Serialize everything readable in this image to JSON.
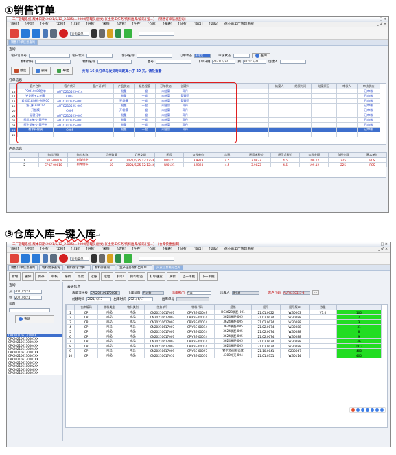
{
  "doc": {
    "heading1": "①销售订单",
    "heading2": "③仓库入库",
    "heading2_emph": "一键入库",
    "return_mark": "↵"
  },
  "shot1": {
    "title": "工厂管理系统(版本日期:2021/5/12_2.105)...2000[管理员(创始)]{主要工作务/统料出库/编码{强...} - [销售订单信息查询]",
    "window_controls": "_ □ ×",
    "menu": [
      "[系统]",
      "[经理]",
      "[业务]",
      "[工程]",
      "[计划]",
      "[供管]",
      "[采购]",
      "[品管]",
      "[生产]",
      "[仓库]",
      "[报表]",
      "[财务]",
      "[窗口]",
      "[帮助]",
      "佰小凿工厂管理系统"
    ],
    "menu_right": "_ ♂ ×",
    "search_placeholder": "查询菜单",
    "tab": "销售订单信息查询",
    "query_label": "查询",
    "form": {
      "order_no": "客户订单号",
      "customer_code": "客户代码",
      "customer_name": "客户名称",
      "order_status": "订单状态",
      "order_status_val": "未结案",
      "review_status": "审核状态",
      "query_btn": "查询",
      "material_code": "物料代码",
      "material_name": "物料名称",
      "drawing": "图号",
      "order_date": "下单日期",
      "date_from": "2021/ 5/22",
      "to": "到",
      "date_to": "2021/ 6/21",
      "creator": "创建人"
    },
    "actions": {
      "lock": "锁定",
      "delete": "删除",
      "export": "导出",
      "notice": "共有 16 条订单与发货时间距离小于 20 天，请及查看"
    },
    "orders_label": "订单信息",
    "orders_headers": [
      "",
      "客户名称",
      "客户代码",
      "客户订单号",
      "产品状态",
      "紧急程度",
      "订单状态",
      "创建人",
      "",
      "结案人",
      "结案时间",
      "结案原因",
      "审核人",
      "审核状态"
    ],
    "orders_rows": [
      [
        "16",
        "POO10486急单",
        "AUTO210525-014",
        "",
        "批量",
        "一般",
        "未结案",
        "郭丹",
        "",
        "",
        "",
        "",
        "",
        "已审核"
      ],
      [
        "17",
        "逆划图+定制窗",
        "C002",
        "",
        "批量",
        "一般",
        "未结案",
        "管理员",
        "",
        "",
        "",
        "",
        "",
        "已审核"
      ],
      [
        "18",
        "紧锁用其制作-创改00",
        "AUTO210525-001",
        "",
        "开袋模",
        "一般",
        "未结案",
        "管理员",
        "",
        "",
        "",
        "",
        "",
        "已审核"
      ],
      [
        "19",
        "急订料ADC12",
        "AUTO210525-001",
        "",
        "批量",
        "一般",
        "未结案",
        "郭丹",
        "",
        "",
        "",
        "",
        "",
        "已审核"
      ],
      [
        "20",
        "开锁模",
        "C009",
        "",
        "开袋模",
        "一般",
        "未结案",
        "郭丹",
        "",
        "",
        "",
        "",
        "",
        "已审核"
      ],
      [
        "21",
        "延验订单",
        "AUTO210525-001",
        "",
        "批量",
        "一般",
        "未结案",
        "郭丹",
        "",
        "",
        "",
        "",
        "",
        "已审核"
      ],
      [
        "22",
        "打机加单交-周子出",
        "AUTO210525-001",
        "",
        "批量",
        "一般",
        "未结案",
        "郭丹",
        "",
        "",
        "",
        "",
        "",
        "已审核"
      ],
      [
        "23",
        "打注塑单交-周子出",
        "AUTO210525-001",
        "",
        "批量",
        "一般",
        "未结案",
        "郭丹",
        "",
        "",
        "",
        "",
        "",
        "已审核"
      ],
      [
        "24",
        "刹车补偿模",
        "C005",
        "",
        "批量",
        "一般",
        "未结案",
        "郭丹",
        "",
        "",
        "",
        "",
        "",
        "已审核"
      ],
      [
        "25",
        "",
        "",
        "",
        "",
        "",
        "",
        "",
        "",
        "",
        "",
        "",
        "",
        ""
      ]
    ],
    "products_label": "产品信息",
    "products_headers": [
      "",
      "物料代码",
      "物料名称",
      "订单数量",
      "订单交期",
      "图号",
      "含税单价",
      "含税",
      "原币未税价",
      "原币含税价",
      "未税金额",
      "含税金额",
      "基本单位"
    ],
    "products_rows": [
      [
        "1",
        "CP-LT-00009",
        "刹车钳补",
        "50",
        "2021/6/25 12:12:46",
        "W.0121",
        "3.9823",
        "4.5",
        "3.9823",
        "4.5",
        "199.12",
        "225",
        "PCS"
      ],
      [
        "2",
        "CP-LT-00010",
        "刹车钳补",
        "50",
        "2021/6/25 12:12:46",
        "W.0121",
        "3.9823",
        "4.5",
        "3.9823",
        "4.5",
        "199.12",
        "225",
        "PCS"
      ]
    ]
  },
  "shot2": {
    "title": "工厂管理系统(版本日期:2021/5/12_2.105)...2000[管理员(创始)]{主要工作务/统料出库/编码{强...} - [仓库快捷出库]",
    "window_controls": "_ □ ×",
    "menu": [
      "[系统]",
      "[经理]",
      "[业务]",
      "[工程]",
      "[计划]",
      "[供管]",
      "[采购]",
      "[品管]",
      "[生产]",
      "[仓库]",
      "[报表]",
      "[财务]",
      "[窗口]",
      "[帮助]",
      "佰小凿工厂管理系统"
    ],
    "menu_right": "_ ♂ ×",
    "search_placeholder": "查询菜单",
    "tabs": [
      "销售订单信息查询",
      "物料需求查询",
      "物料需求计算...",
      "物料库查询...",
      "生产任务物料出库单...",
      "交货信息概览出库"
    ],
    "actions": [
      "新增",
      "删除",
      "保存",
      "审核",
      "编辑",
      "作废",
      "过账",
      "定位",
      "打印",
      "打印标签",
      "打印送货",
      "刷新",
      "上一单据",
      "下一单据"
    ],
    "query_label": "查询",
    "from_label": "从",
    "from_date": "2021/ 5/22",
    "to_label": "到",
    "to_date": "2021/ 6/21",
    "status_label": "状态",
    "query_btn": "查询",
    "doc_list": [
      "CPK202106170000X",
      "CPK202106170007XX",
      "CPK202106170004XX",
      "CPK202106170004XX",
      "CPK202106170004XX",
      "CPK202106170001XX",
      "CPK202106170001XX",
      "CPK202106170001XX",
      "CPK202106170001XX",
      "CPK202106110002XX",
      "CPK202106100000XX",
      "CPK202106180001XX"
    ],
    "header_label": "表头信息",
    "header": {
      "out_no_label": "表单流水号",
      "out_no": "CPK202106170006",
      "out_status_label": "出库状态",
      "out_status": "已过账",
      "dept_label": "出库部门",
      "dept": "仓库",
      "person_label": "出库人",
      "person": "郭小凿",
      "customer_label": "客户代码",
      "customer": "AUTO210525-8",
      "date_label": "创建时间",
      "date": "2021/ 6/17",
      "out_date_label": "出库时间",
      "out_date": "2021/ 6/17",
      "out_ref_label": "出库单号"
    },
    "items_headers": [
      "",
      "仓库编码",
      "物料类型",
      "物料类别",
      "任务单号",
      "物料代码",
      "规格",
      "图号",
      "图号版本",
      "数量"
    ],
    "items_rows": [
      [
        "1",
        "CP",
        "成品",
        "成品",
        "CN20210617007",
        "CP-YBE-00049",
        "HC3628装配-001",
        "21.01.0022",
        "W.30003",
        "V1.0",
        "100"
      ],
      [
        "2",
        "CP",
        "成品",
        "成品",
        "CN20210617007",
        "CP-YBE-00014",
        "3624装配-005",
        "21.02.0074",
        "W.30088",
        "",
        "7"
      ],
      [
        "3",
        "CP",
        "成品",
        "成品",
        "CN20210617007",
        "CP-YBE-00014",
        "3624装配-005",
        "21.02.0074",
        "W.30088",
        "",
        "3"
      ],
      [
        "4",
        "CP",
        "成品",
        "成品",
        "CN20210617007",
        "CP-YBE-00014",
        "3624装配-005",
        "21.02.0074",
        "W.30088",
        "",
        "31"
      ],
      [
        "5",
        "CP",
        "成品",
        "成品",
        "CN20210617007",
        "CP-YBE-00014",
        "3624装配-005",
        "21.02.0074",
        "W.30088",
        "",
        "8"
      ],
      [
        "6",
        "CP",
        "成品",
        "成品",
        "CN20210617007",
        "CP-YBE-00014",
        "3624装配-005",
        "21.02.0074",
        "W.30088",
        "",
        "9"
      ],
      [
        "7",
        "CP",
        "成品",
        "成品",
        "CN20210617007",
        "CP-YBE-00014",
        "3624装配-005",
        "21.02.0074",
        "W.30088",
        "",
        "46"
      ],
      [
        "8",
        "CP",
        "成品",
        "成品",
        "CN20210617007",
        "CP-YBE-00014",
        "3624装配-005",
        "21.02.0074",
        "W.30088",
        "",
        "1912"
      ],
      [
        "9",
        "CP",
        "成品",
        "成品",
        "CN20210617009",
        "CP-YBE-00097",
        "霍尔加速器 匹盒",
        "21.10.0041",
        "S230067",
        "",
        "400"
      ],
      [
        "10",
        "CP",
        "成品",
        "成品",
        "CN20210617010",
        "CP-YBE-00010",
        "4300外壳-004",
        "21.01.0351",
        "W.30114",
        "",
        "400"
      ]
    ]
  }
}
